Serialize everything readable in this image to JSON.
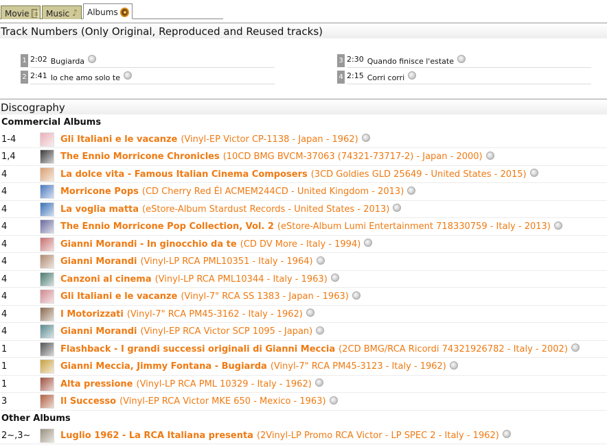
{
  "tabs": [
    {
      "label": "Movie",
      "icon": "film-icon"
    },
    {
      "label": "Music",
      "icon": "music-note-icon"
    },
    {
      "label": "Albums",
      "icon": "disc-icon",
      "active": true
    }
  ],
  "track_section": {
    "title": "Track Numbers (Only Original, Reproduced and Reused tracks)",
    "tracks": [
      {
        "no": "1",
        "time": "2:02",
        "title": "Bugiarda"
      },
      {
        "no": "2",
        "time": "2:41",
        "title": "Io che amo solo te"
      },
      {
        "no": "3",
        "time": "2:30",
        "title": "Quando finisce l'estate"
      },
      {
        "no": "4",
        "time": "2:15",
        "title": "Corri corri"
      }
    ]
  },
  "discography": {
    "title": "Discography",
    "commercial_label": "Commercial Albums",
    "other_label": "Other Albums",
    "commercial": [
      {
        "disc": "1-4",
        "title": "Gli Italiani e le vacanze",
        "info": "(Vinyl-EP Victor CP-1138 - Japan - 1962)",
        "cover": "#e8b0b8"
      },
      {
        "disc": "1,4",
        "title": "The Ennio Morricone Chronicles",
        "info": "(10CD BMG BVCM-37063 (74321-73717-2) - Japan - 2000)",
        "cover": "#3a3a3a"
      },
      {
        "disc": "4",
        "title": "La dolce vita - Famous Italian Cinema Composers",
        "info": "(3CD Goldies GLD 25649 - United States - 2015)",
        "cover": "#d9a070"
      },
      {
        "disc": "4",
        "title": "Morricone Pops",
        "info": "(CD Cherry Red Él ACMEM244CD - United Kingdom - 2013)",
        "cover": "#4a78c0"
      },
      {
        "disc": "4",
        "title": "La voglia matta",
        "info": "(eStore-Album Stardust Records - United States - 2013)",
        "cover": "#3a70b8"
      },
      {
        "disc": "4",
        "title": "The Ennio Morricone Pop Collection, Vol. 2",
        "info": "(eStore-Album Lumi Entertainment 718330759 - Italy - 2013)",
        "cover": "#6a6aa0"
      },
      {
        "disc": "4",
        "title": "Gianni Morandi - In ginocchio da te",
        "info": "(CD DV More - Italy - 1994)",
        "cover": "#c87070"
      },
      {
        "disc": "4",
        "title": "Gianni Morandi",
        "info": "(Vinyl-LP RCA PML10351 - Italy - 1964)",
        "cover": "#b08a70"
      },
      {
        "disc": "4",
        "title": "Canzoni al cinema",
        "info": "(Vinyl-LP RCA PML10344 - Italy - 1963)",
        "cover": "#4a7a70"
      },
      {
        "disc": "4",
        "title": "Gli Italiani e le vacanze",
        "info": "(Vinyl-7\" RCA SS 1383 - Japan - 1963)",
        "cover": "#d08890"
      },
      {
        "disc": "4",
        "title": "I Motorizzati",
        "info": "(Vinyl-7\" RCA PM45-3162 - Italy - 1962)",
        "cover": "#8a6a50"
      },
      {
        "disc": "4",
        "title": "Gianni Morandi",
        "info": "(Vinyl-EP RCA Victor SCP 1095 - Japan)",
        "cover": "#5a8a90"
      },
      {
        "disc": "1",
        "title": "Flashback - I grandi successi originali di Gianni Meccia",
        "info": "(2CD BMG/RCA Ricordi 74321926782 - Italy - 2002)",
        "cover": "#555555"
      },
      {
        "disc": "1",
        "title": "Gianni Meccia, Jimmy Fontana - Bugiarda",
        "info": "(Vinyl-7\" RCA PM45-3123 - Italy - 1962)",
        "cover": "#c8a040"
      },
      {
        "disc": "1",
        "title": "Alta pressione",
        "info": "(Vinyl-LP RCA PML 10329 - Italy - 1962)",
        "cover": "#a05040"
      },
      {
        "disc": "3",
        "title": "Il Successo",
        "info": "(Vinyl-EP RCA Victor MKE 650 - Mexico - 1963)",
        "cover": "#b06040"
      }
    ],
    "other": [
      {
        "disc": "2~,3~",
        "title": "Luglio 1962 - La RCA Italiana presenta",
        "info": "(2Vinyl-LP Promo RCA Victor - LP SPEC 2 - Italy - 1962)",
        "cover": "#9a9080"
      }
    ]
  }
}
